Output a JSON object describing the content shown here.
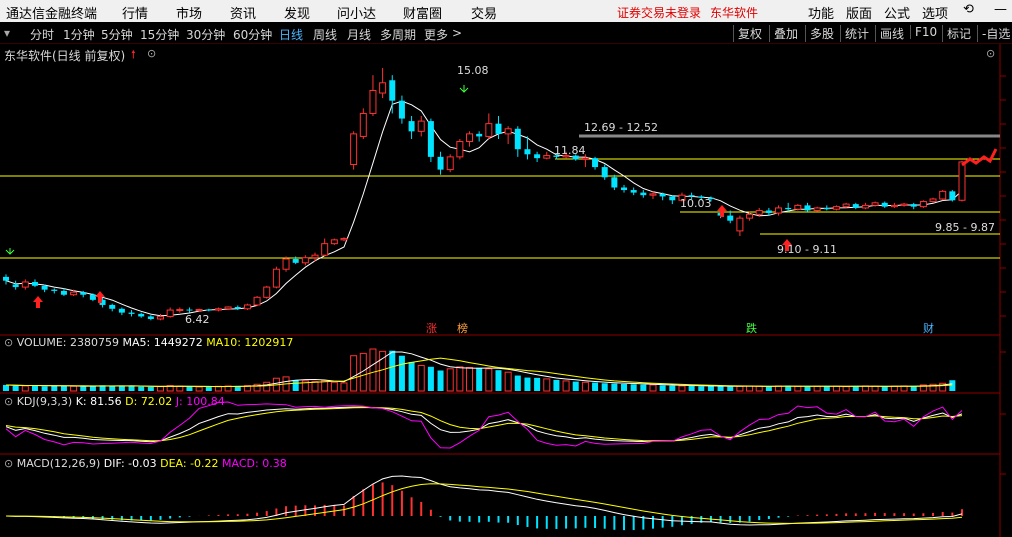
{
  "menubar": {
    "app_name": "通达信金融终端",
    "menus": [
      "行情",
      "市场",
      "资讯",
      "发现",
      "问小达",
      "财富圈",
      "交易"
    ],
    "login_warning": "证券交易未登录",
    "stock_link": "东华软件",
    "right_menus": [
      "功能",
      "版面",
      "公式",
      "选项"
    ]
  },
  "periods": [
    "分时",
    "1分钟",
    "5分钟",
    "15分钟",
    "30分钟",
    "60分钟",
    "日线",
    "周线",
    "月线",
    "多周期",
    "更多"
  ],
  "active_period": "日线",
  "toolbar": [
    "复权",
    "叠加",
    "多股",
    "统计",
    "画线",
    "F10",
    "标记",
    "-自选"
  ],
  "chart_title": "东华软件(日线 前复权)",
  "price_annotations": {
    "high": "15.08",
    "low": "6.42",
    "range1": "12.69 - 12.52",
    "level1": "11.84",
    "level2": "10.03",
    "range2": "9.85 - 9.87",
    "range3": "9.10 - 9.11"
  },
  "events": [
    "涨",
    "榜",
    "跌",
    "财"
  ],
  "volume": {
    "label": "VOLUME: 2380759",
    "ma5": "MA5: 1449272",
    "ma10": "MA10: 1202917"
  },
  "kdj": {
    "label": "KDJ(9,3,3)",
    "k": "K: 81.56",
    "d": "D: 72.02",
    "j": "J: 100.84"
  },
  "macd": {
    "label": "MACD(12,26,9)",
    "dif": "DIF: -0.03",
    "dea": "DEA: -0.22",
    "macd": "MACD: 0.38"
  },
  "colors": {
    "up": "#ff3232",
    "down": "#00e4ff",
    "ma5": "#ffffff",
    "ma10": "#ffff00",
    "j": "#ff00ff",
    "accent": "#49b4ff"
  },
  "chart_data": {
    "type": "candlestick",
    "series": [
      {
        "o": 6.9,
        "c": 6.75,
        "h": 7.0,
        "l": 6.6
      },
      {
        "o": 6.6,
        "c": 6.5,
        "h": 6.75,
        "l": 6.4
      },
      {
        "o": 6.5,
        "c": 6.7,
        "h": 6.8,
        "l": 6.4
      },
      {
        "o": 6.7,
        "c": 6.55,
        "h": 6.8,
        "l": 6.5
      },
      {
        "o": 6.55,
        "c": 6.4,
        "h": 6.6,
        "l": 6.3
      },
      {
        "o": 6.4,
        "c": 6.35,
        "h": 6.45,
        "l": 6.25
      },
      {
        "o": 6.35,
        "c": 6.2,
        "h": 6.45,
        "l": 6.15
      },
      {
        "o": 6.2,
        "c": 6.3,
        "h": 6.4,
        "l": 6.15
      },
      {
        "o": 6.3,
        "c": 6.2,
        "h": 6.35,
        "l": 6.1
      },
      {
        "o": 6.2,
        "c": 6.0,
        "h": 6.25,
        "l": 5.95
      },
      {
        "o": 6.0,
        "c": 5.8,
        "h": 6.1,
        "l": 5.7
      },
      {
        "o": 5.8,
        "c": 5.65,
        "h": 5.85,
        "l": 5.55
      },
      {
        "o": 5.65,
        "c": 5.5,
        "h": 5.7,
        "l": 5.4
      },
      {
        "o": 5.5,
        "c": 5.45,
        "h": 5.6,
        "l": 5.35
      },
      {
        "o": 5.45,
        "c": 5.35,
        "h": 5.5,
        "l": 5.3
      },
      {
        "o": 5.35,
        "c": 5.25,
        "h": 5.4,
        "l": 5.2
      },
      {
        "o": 5.25,
        "c": 5.35,
        "h": 5.45,
        "l": 5.2
      },
      {
        "o": 5.35,
        "c": 5.6,
        "h": 5.7,
        "l": 5.3
      },
      {
        "o": 5.6,
        "c": 5.62,
        "h": 5.7,
        "l": 5.5
      },
      {
        "o": 5.62,
        "c": 5.6,
        "h": 5.7,
        "l": 5.5
      },
      {
        "o": 5.6,
        "c": 5.62,
        "h": 5.66,
        "l": 5.55
      },
      {
        "o": 5.62,
        "c": 5.6,
        "h": 5.65,
        "l": 5.55
      },
      {
        "o": 5.6,
        "c": 5.65,
        "h": 5.7,
        "l": 5.55
      },
      {
        "o": 5.65,
        "c": 5.72,
        "h": 5.75,
        "l": 5.6
      },
      {
        "o": 5.72,
        "c": 5.65,
        "h": 5.78,
        "l": 5.6
      },
      {
        "o": 5.65,
        "c": 5.8,
        "h": 5.85,
        "l": 5.6
      },
      {
        "o": 5.8,
        "c": 6.1,
        "h": 6.15,
        "l": 5.75
      },
      {
        "o": 6.1,
        "c": 6.5,
        "h": 6.55,
        "l": 6.05
      },
      {
        "o": 6.5,
        "c": 7.2,
        "h": 7.3,
        "l": 6.45
      },
      {
        "o": 7.2,
        "c": 7.6,
        "h": 7.7,
        "l": 7.1
      },
      {
        "o": 7.6,
        "c": 7.45,
        "h": 7.7,
        "l": 7.4
      },
      {
        "o": 7.45,
        "c": 7.65,
        "h": 7.75,
        "l": 7.35
      },
      {
        "o": 7.65,
        "c": 7.75,
        "h": 7.85,
        "l": 7.5
      },
      {
        "o": 7.75,
        "c": 8.2,
        "h": 8.4,
        "l": 7.7
      },
      {
        "o": 8.2,
        "c": 8.35,
        "h": 8.4,
        "l": 8.15
      },
      {
        "o": 8.35,
        "c": 8.4,
        "h": 8.45,
        "l": 8.3
      },
      {
        "o": 11.3,
        "c": 12.5,
        "h": 12.6,
        "l": 11.1
      },
      {
        "o": 12.4,
        "c": 13.3,
        "h": 13.5,
        "l": 12.3
      },
      {
        "o": 13.3,
        "c": 14.2,
        "h": 14.8,
        "l": 13.2
      },
      {
        "o": 14.1,
        "c": 14.5,
        "h": 15.08,
        "l": 13.9
      },
      {
        "o": 14.6,
        "c": 13.8,
        "h": 14.8,
        "l": 13.3
      },
      {
        "o": 13.8,
        "c": 13.1,
        "h": 14.0,
        "l": 12.9
      },
      {
        "o": 13.0,
        "c": 12.6,
        "h": 13.2,
        "l": 12.3
      },
      {
        "o": 12.6,
        "c": 13.0,
        "h": 13.2,
        "l": 12.4
      },
      {
        "o": 13.0,
        "c": 11.6,
        "h": 13.1,
        "l": 11.4
      },
      {
        "o": 11.6,
        "c": 11.1,
        "h": 11.8,
        "l": 10.9
      },
      {
        "o": 11.1,
        "c": 11.6,
        "h": 11.7,
        "l": 11.0
      },
      {
        "o": 11.6,
        "c": 12.2,
        "h": 12.3,
        "l": 11.5
      },
      {
        "o": 12.2,
        "c": 12.5,
        "h": 12.6,
        "l": 12.0
      },
      {
        "o": 12.5,
        "c": 12.4,
        "h": 12.6,
        "l": 12.2
      },
      {
        "o": 12.4,
        "c": 12.9,
        "h": 13.3,
        "l": 12.3
      },
      {
        "o": 12.9,
        "c": 12.5,
        "h": 13.2,
        "l": 12.3
      },
      {
        "o": 12.5,
        "c": 12.7,
        "h": 12.8,
        "l": 12.1
      },
      {
        "o": 12.7,
        "c": 11.9,
        "h": 12.8,
        "l": 11.6
      },
      {
        "o": 11.9,
        "c": 11.7,
        "h": 12.4,
        "l": 11.5
      },
      {
        "o": 11.7,
        "c": 11.55,
        "h": 11.8,
        "l": 11.4
      },
      {
        "o": 11.55,
        "c": 11.65,
        "h": 11.8,
        "l": 11.5
      },
      {
        "o": 11.65,
        "c": 11.6,
        "h": 11.7,
        "l": 11.5
      },
      {
        "o": 11.6,
        "c": 11.65,
        "h": 11.8,
        "l": 11.55
      },
      {
        "o": 11.65,
        "c": 11.5,
        "h": 11.7,
        "l": 11.45
      },
      {
        "o": 11.5,
        "c": 11.55,
        "h": 11.7,
        "l": 11.2
      },
      {
        "o": 11.55,
        "c": 11.2,
        "h": 11.6,
        "l": 11.1
      },
      {
        "o": 11.2,
        "c": 10.8,
        "h": 11.3,
        "l": 10.7
      },
      {
        "o": 10.8,
        "c": 10.4,
        "h": 10.9,
        "l": 10.3
      },
      {
        "o": 10.4,
        "c": 10.3,
        "h": 10.5,
        "l": 10.2
      },
      {
        "o": 10.3,
        "c": 10.2,
        "h": 10.4,
        "l": 10.1
      },
      {
        "o": 10.2,
        "c": 10.1,
        "h": 10.3,
        "l": 10.0
      },
      {
        "o": 10.1,
        "c": 10.15,
        "h": 10.25,
        "l": 9.95
      },
      {
        "o": 10.15,
        "c": 10.05,
        "h": 10.2,
        "l": 9.9
      },
      {
        "o": 10.05,
        "c": 9.9,
        "h": 10.1,
        "l": 9.75
      },
      {
        "o": 9.9,
        "c": 10.1,
        "h": 10.2,
        "l": 9.85
      },
      {
        "o": 10.1,
        "c": 10.05,
        "h": 10.2,
        "l": 9.95
      },
      {
        "o": 10.05,
        "c": 10.0,
        "h": 10.1,
        "l": 9.9
      },
      {
        "o": 10.0,
        "c": 9.95,
        "h": 10.05,
        "l": 9.85
      },
      {
        "o": 9.4,
        "c": 9.3,
        "h": 9.5,
        "l": 9.2
      },
      {
        "o": 9.3,
        "c": 9.1,
        "h": 9.5,
        "l": 9.0
      },
      {
        "o": 8.7,
        "c": 9.2,
        "h": 9.3,
        "l": 8.5
      },
      {
        "o": 9.2,
        "c": 9.35,
        "h": 9.45,
        "l": 9.1
      },
      {
        "o": 9.35,
        "c": 9.5,
        "h": 9.6,
        "l": 9.25
      },
      {
        "o": 9.5,
        "c": 9.4,
        "h": 9.6,
        "l": 9.3
      },
      {
        "o": 9.4,
        "c": 9.6,
        "h": 9.7,
        "l": 9.3
      },
      {
        "o": 9.6,
        "c": 9.55,
        "h": 9.8,
        "l": 9.45
      },
      {
        "o": 9.55,
        "c": 9.7,
        "h": 9.75,
        "l": 9.5
      },
      {
        "o": 9.7,
        "c": 9.5,
        "h": 9.8,
        "l": 9.45
      },
      {
        "o": 9.5,
        "c": 9.6,
        "h": 9.65,
        "l": 9.45
      },
      {
        "o": 9.6,
        "c": 9.55,
        "h": 9.7,
        "l": 9.5
      },
      {
        "o": 9.55,
        "c": 9.65,
        "h": 9.7,
        "l": 9.5
      },
      {
        "o": 9.65,
        "c": 9.75,
        "h": 9.8,
        "l": 9.6
      },
      {
        "o": 9.75,
        "c": 9.6,
        "h": 9.8,
        "l": 9.55
      },
      {
        "o": 9.6,
        "c": 9.7,
        "h": 9.8,
        "l": 9.55
      },
      {
        "o": 9.7,
        "c": 9.8,
        "h": 9.85,
        "l": 9.65
      },
      {
        "o": 9.8,
        "c": 9.65,
        "h": 9.85,
        "l": 9.6
      },
      {
        "o": 9.65,
        "c": 9.7,
        "h": 9.8,
        "l": 9.6
      },
      {
        "o": 9.7,
        "c": 9.75,
        "h": 9.8,
        "l": 9.65
      },
      {
        "o": 9.75,
        "c": 9.65,
        "h": 9.8,
        "l": 9.55
      },
      {
        "o": 9.65,
        "c": 9.85,
        "h": 9.9,
        "l": 9.6
      },
      {
        "o": 9.85,
        "c": 9.95,
        "h": 10.0,
        "l": 9.8
      },
      {
        "o": 9.95,
        "c": 10.25,
        "h": 10.3,
        "l": 9.9
      },
      {
        "o": 10.25,
        "c": 9.9,
        "h": 10.3,
        "l": 9.85
      },
      {
        "o": 9.9,
        "c": 11.4,
        "h": 11.45,
        "l": 9.85
      }
    ],
    "volume": [
      180,
      160,
      150,
      170,
      140,
      160,
      150,
      140,
      130,
      150,
      170,
      160,
      150,
      140,
      130,
      120,
      130,
      160,
      140,
      130,
      120,
      130,
      140,
      150,
      140,
      160,
      200,
      260,
      380,
      420,
      330,
      300,
      280,
      310,
      260,
      240,
      1050,
      1120,
      1250,
      1180,
      1200,
      1050,
      860,
      760,
      720,
      610,
      660,
      720,
      700,
      690,
      660,
      620,
      560,
      460,
      400,
      390,
      360,
      330,
      300,
      280,
      260,
      250,
      230,
      220,
      210,
      200,
      190,
      180,
      170,
      160,
      150,
      160,
      140,
      150,
      140,
      130,
      140,
      150,
      140,
      130,
      150,
      160,
      140,
      130,
      140,
      150,
      140,
      130,
      140,
      150,
      140,
      130,
      140,
      150,
      140,
      180,
      200,
      230,
      320
    ],
    "xlabel": "",
    "ylabel": ""
  }
}
